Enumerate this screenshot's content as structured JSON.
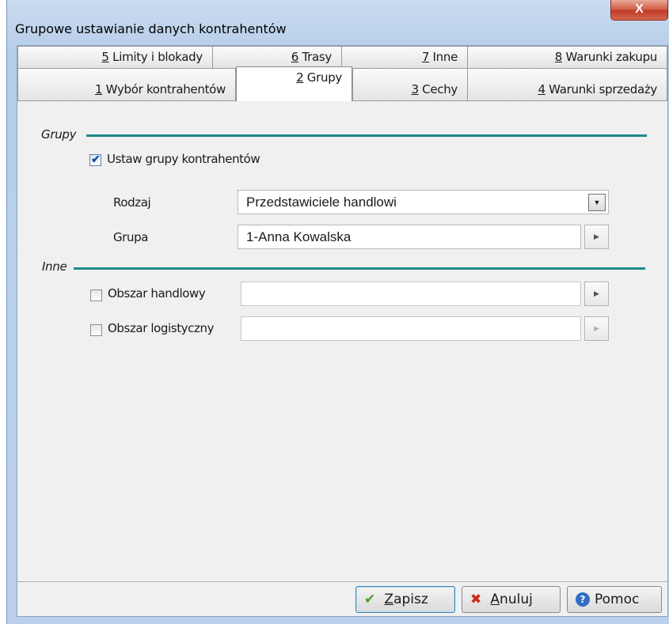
{
  "window": {
    "title": "Grupowe ustawianie danych kontrahentów",
    "close_label": "X"
  },
  "tabs_top": [
    {
      "num": "5",
      "text": " Limity i blokady"
    },
    {
      "num": "6",
      "text": " Trasy"
    },
    {
      "num": "7",
      "text": " Inne"
    },
    {
      "num": "8",
      "text": " Warunki zakupu"
    }
  ],
  "tabs_bottom": [
    {
      "num": "1",
      "text": " Wybór kontrahentów"
    },
    {
      "num": "2",
      "text": " Grupy"
    },
    {
      "num": "3",
      "text": " Cechy"
    },
    {
      "num": "4",
      "text": " Warunki sprzedaży"
    }
  ],
  "grupy": {
    "section_label": "Grupy",
    "checkbox_label": "Ustaw grupy kontrahentów",
    "checked": true,
    "rodzaj_label": "Rodzaj",
    "rodzaj_value": "Przedstawiciele handlowi",
    "grupa_label": "Grupa",
    "grupa_value": "1-Anna Kowalska"
  },
  "inne": {
    "section_label": "Inne",
    "obszar_handlowy_label": "Obszar handlowy",
    "obszar_handlowy_value": "",
    "obszar_logistyczny_label": "Obszar logistyczny",
    "obszar_logistyczny_value": ""
  },
  "buttons": {
    "save_prefix": "",
    "save_underlined": "Z",
    "save_rest": "apisz",
    "cancel_underlined": "A",
    "cancel_rest": "nuluj",
    "help": "Pomoc"
  },
  "icons": {
    "checkmark_glyph": "✔",
    "cancel_glyph": "✖",
    "help_glyph": "?",
    "dropdown_glyph": "▼",
    "arrow_glyph": "▶"
  },
  "colors": {
    "section_line": "#1f8a8a",
    "save_icon": "#4a9a2a",
    "cancel_icon": "#d02a1a",
    "help_icon": "#2f6fc4"
  }
}
